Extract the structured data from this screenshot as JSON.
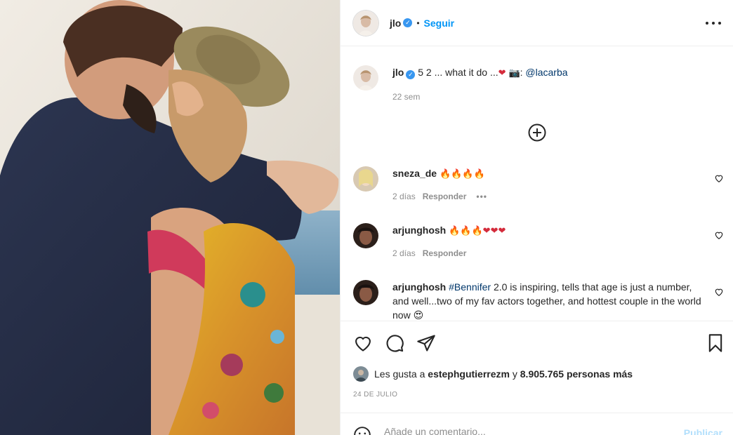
{
  "post": {
    "username": "jlo",
    "verified_mark": "✓",
    "separator": "•",
    "follow_label": "Seguir",
    "caption_text": "5 2 ... what it do ...",
    "caption_emoji_heart": "❤",
    "caption_camera_emoji": "📷",
    "caption_credit": ":",
    "caption_mention": "@lacarba",
    "caption_age": "22 sem"
  },
  "comments": [
    {
      "username": "sneza_de",
      "text": "🔥🔥🔥🔥",
      "age": "2 días",
      "reply_label": "Responder",
      "more": "•••"
    },
    {
      "username": "arjunghosh",
      "text": "🔥🔥🔥❤❤❤",
      "age": "2 días",
      "reply_label": "Responder"
    },
    {
      "username": "arjunghosh",
      "hashtag": "#Bennifer",
      "text": " 2.0 is inspiring, tells that age is just a number, and well...two of my fav actors together, and hottest couple in the world now 😍"
    }
  ],
  "likes": {
    "prefix": "Les gusta a",
    "user": "estephgutierrezm",
    "connector": "y",
    "count_text": "8.905.765 personas más"
  },
  "date": "24 DE JULIO",
  "add_comment": {
    "placeholder": "Añade un comentario...",
    "publish_label": "Publicar"
  }
}
